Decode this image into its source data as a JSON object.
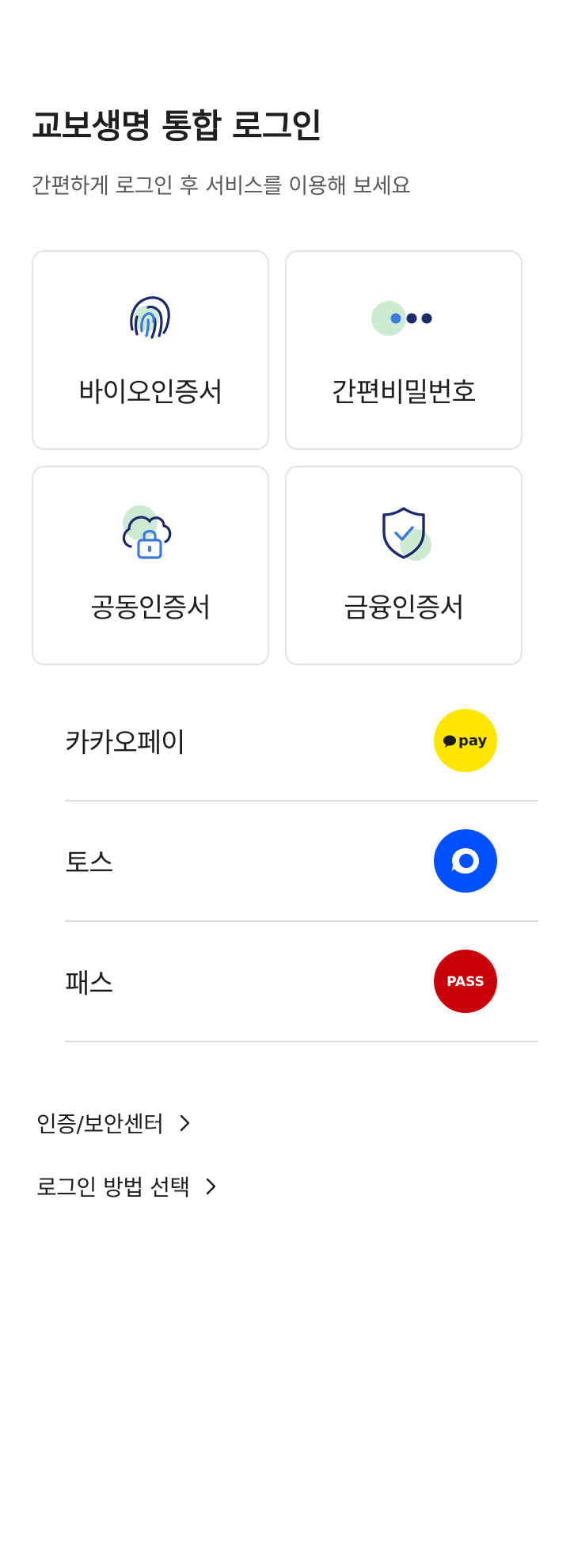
{
  "header": {
    "title": "교보생명 통합 로그인",
    "subtitle": "간편하게 로그인 후 서비스를 이용해 보세요"
  },
  "auth_cards": [
    {
      "label": "바이오인증서",
      "icon": "fingerprint-icon"
    },
    {
      "label": "간편비밀번호",
      "icon": "pin-dots-icon"
    },
    {
      "label": "공동인증서",
      "icon": "cloud-lock-icon"
    },
    {
      "label": "금융인증서",
      "icon": "shield-check-icon"
    }
  ],
  "providers": [
    {
      "label": "카카오페이",
      "logo_text": "pay",
      "color": "#FFE600",
      "icon": "kakaopay-logo-icon"
    },
    {
      "label": "토스",
      "logo_text": "",
      "color": "#0050FF",
      "icon": "toss-logo-icon"
    },
    {
      "label": "패스",
      "logo_text": "PASS",
      "color": "#C8000A",
      "icon": "pass-logo-icon"
    }
  ],
  "links": [
    {
      "label": "인증/보안센터",
      "icon": "chevron-right-icon"
    },
    {
      "label": "로그인 방법 선택",
      "icon": "chevron-right-icon"
    }
  ],
  "colors": {
    "navy": "#1B2A6B",
    "blue": "#3B7BE0",
    "mint": "#CDEBD2",
    "border": "#E4E4E4",
    "divider": "#DCDCDC"
  }
}
